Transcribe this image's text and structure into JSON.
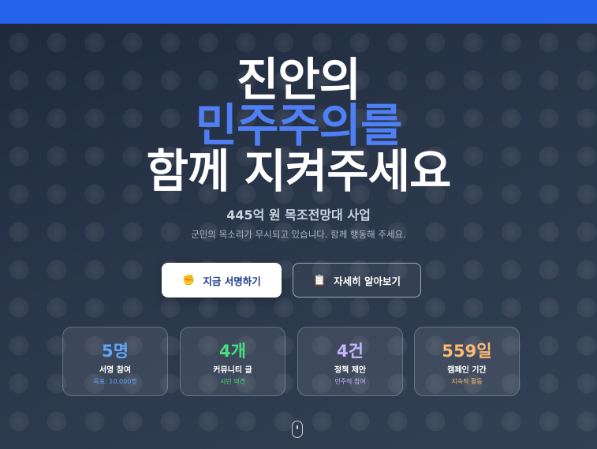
{
  "hero": {
    "line1": "진안의",
    "line2": "민주주의를",
    "line3": "함께 지켜주세요",
    "subtitle": "445억 원 목조전망대 사업",
    "description": "군민의 목소리가 무시되고 있습니다. 함께 행동해 주세요."
  },
  "buttons": {
    "sign": {
      "icon": "✊",
      "icon_name": "raised-fist-icon",
      "label": "지금 서명하기"
    },
    "learn": {
      "icon": "📋",
      "icon_name": "clipboard-icon",
      "label": "자세히 알아보기"
    }
  },
  "stats": [
    {
      "value": "5명",
      "label": "서명 참여",
      "note": "목표: 10,000명",
      "color": "#60a5fa"
    },
    {
      "value": "4개",
      "label": "커뮤니티 글",
      "note": "시민 의견",
      "color": "#4ade80"
    },
    {
      "value": "4건",
      "label": "정책 제안",
      "note": "민주적 참여",
      "color": "#c4b5fd"
    },
    {
      "value": "559일",
      "label": "캠페인 기간",
      "note": "지속적 활동",
      "color": "#fdba74"
    }
  ],
  "colors": {
    "top_bar": "#2563eb",
    "accent": "#4f7ff5"
  }
}
